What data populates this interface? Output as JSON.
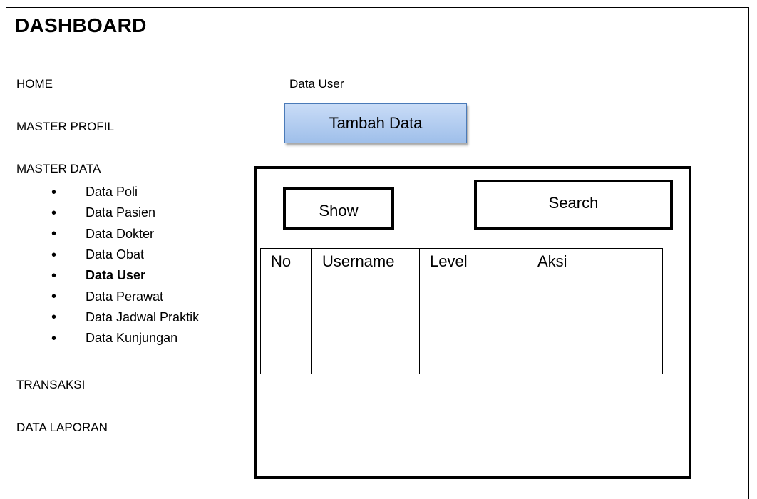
{
  "app": {
    "title": "DASHBOARD"
  },
  "nav": {
    "home": "HOME",
    "master_profil": "MASTER PROFIL",
    "master_data": "MASTER DATA",
    "master_data_items": [
      {
        "label": "Data Poli",
        "active": false
      },
      {
        "label": "Data Pasien",
        "active": false
      },
      {
        "label": "Data Dokter",
        "active": false
      },
      {
        "label": "Data Obat",
        "active": false
      },
      {
        "label": "Data User",
        "active": true
      },
      {
        "label": "Data Perawat",
        "active": false
      },
      {
        "label": "Data Jadwal Praktik",
        "active": false
      },
      {
        "label": "Data Kunjungan",
        "active": false
      }
    ],
    "transaksi": "TRANSAKSI",
    "data_laporan": "DATA LAPORAN"
  },
  "main": {
    "section_title": "Data User",
    "add_button_label": "Tambah Data",
    "show_label": "Show",
    "search_label": "Search",
    "table": {
      "columns": [
        "No",
        "Username",
        "Level",
        "Aksi"
      ],
      "rows": [
        [
          "",
          "",
          "",
          ""
        ],
        [
          "",
          "",
          "",
          ""
        ],
        [
          "",
          "",
          "",
          ""
        ],
        [
          "",
          "",
          "",
          ""
        ]
      ]
    }
  }
}
